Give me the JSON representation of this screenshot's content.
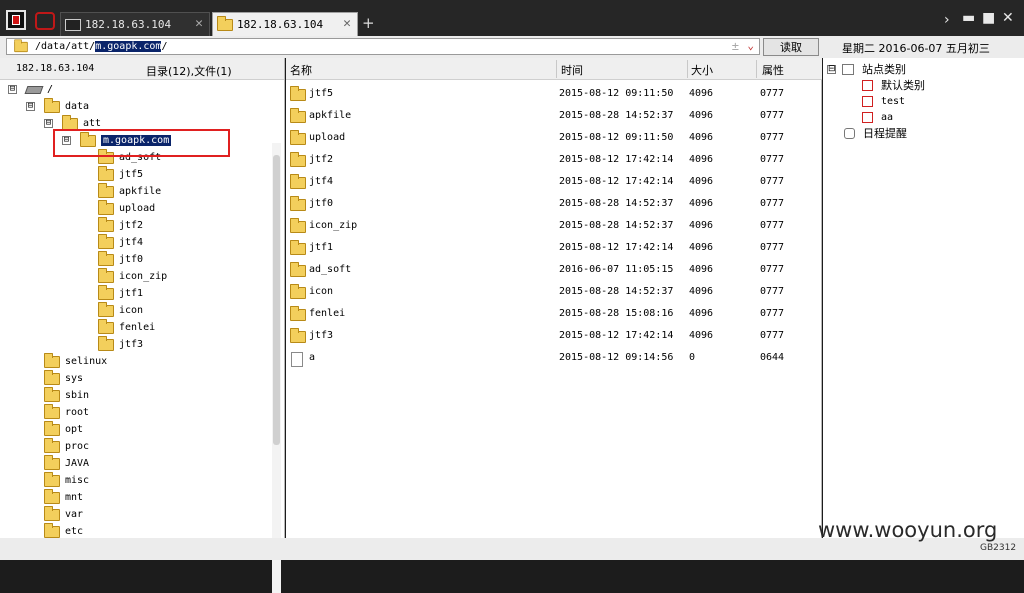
{
  "tabs": [
    {
      "label": "182.18.63.104",
      "active": false
    },
    {
      "label": "182.18.63.104",
      "active": true
    }
  ],
  "window_controls": {
    "more": "›",
    "minimize": "▬",
    "maximize": "■",
    "close": "✕"
  },
  "new_tab": "+",
  "address": {
    "prefix": "/data/att/",
    "selected": "m.goapk.com",
    "suffix": "/",
    "plus": "±",
    "chevron": "⌄"
  },
  "read_button": "读取",
  "date_line": "星期二 2016-06-07 五月初三",
  "left_pane": {
    "host": "182.18.63.104",
    "dir_count": "目录(12),文件(1)",
    "tree": [
      {
        "label": "/",
        "expander": "⊟",
        "icon": "drive-icon"
      },
      {
        "label": "data",
        "expander": "⊟",
        "icon": "folder-icon"
      },
      {
        "label": "att",
        "expander": "⊟",
        "icon": "folder-icon"
      },
      {
        "label": "m.goapk.com",
        "expander": "⊟",
        "icon": "folder-icon",
        "selected": true
      },
      {
        "label": "ad_soft",
        "icon": "folder-icon"
      },
      {
        "label": "jtf5",
        "icon": "folder-icon"
      },
      {
        "label": "apkfile",
        "icon": "folder-icon"
      },
      {
        "label": "upload",
        "icon": "folder-icon"
      },
      {
        "label": "jtf2",
        "icon": "folder-icon"
      },
      {
        "label": "jtf4",
        "icon": "folder-icon"
      },
      {
        "label": "jtf0",
        "icon": "folder-icon"
      },
      {
        "label": "icon_zip",
        "icon": "folder-icon"
      },
      {
        "label": "jtf1",
        "icon": "folder-icon"
      },
      {
        "label": "icon",
        "icon": "folder-icon"
      },
      {
        "label": "fenlei",
        "icon": "folder-icon"
      },
      {
        "label": "jtf3",
        "icon": "folder-icon"
      },
      {
        "label": "selinux",
        "icon": "folder-icon"
      },
      {
        "label": "sys",
        "icon": "folder-icon"
      },
      {
        "label": "sbin",
        "icon": "folder-icon"
      },
      {
        "label": "root",
        "icon": "folder-icon"
      },
      {
        "label": "opt",
        "icon": "folder-icon"
      },
      {
        "label": "proc",
        "icon": "folder-icon"
      },
      {
        "label": "JAVA",
        "icon": "folder-icon"
      },
      {
        "label": "misc",
        "icon": "folder-icon"
      },
      {
        "label": "mnt",
        "icon": "folder-icon"
      },
      {
        "label": "var",
        "icon": "folder-icon"
      },
      {
        "label": "etc",
        "icon": "folder-icon"
      }
    ]
  },
  "file_list": {
    "headers": {
      "name": "名称",
      "time": "时间",
      "size": "大小",
      "attr": "属性"
    },
    "rows": [
      {
        "name": "jtf5",
        "time": "2015-08-12 09:11:50",
        "size": "4096",
        "attr": "0777",
        "icon": "folder-icon"
      },
      {
        "name": "apkfile",
        "time": "2015-08-28 14:52:37",
        "size": "4096",
        "attr": "0777",
        "icon": "folder-icon"
      },
      {
        "name": "upload",
        "time": "2015-08-12 09:11:50",
        "size": "4096",
        "attr": "0777",
        "icon": "folder-icon"
      },
      {
        "name": "jtf2",
        "time": "2015-08-12 17:42:14",
        "size": "4096",
        "attr": "0777",
        "icon": "folder-icon"
      },
      {
        "name": "jtf4",
        "time": "2015-08-12 17:42:14",
        "size": "4096",
        "attr": "0777",
        "icon": "folder-icon"
      },
      {
        "name": "jtf0",
        "time": "2015-08-28 14:52:37",
        "size": "4096",
        "attr": "0777",
        "icon": "folder-icon"
      },
      {
        "name": "icon_zip",
        "time": "2015-08-28 14:52:37",
        "size": "4096",
        "attr": "0777",
        "icon": "folder-icon"
      },
      {
        "name": "jtf1",
        "time": "2015-08-12 17:42:14",
        "size": "4096",
        "attr": "0777",
        "icon": "folder-icon"
      },
      {
        "name": "ad_soft",
        "time": "2016-06-07 11:05:15",
        "size": "4096",
        "attr": "0777",
        "icon": "folder-icon"
      },
      {
        "name": "icon",
        "time": "2015-08-28 14:52:37",
        "size": "4096",
        "attr": "0777",
        "icon": "folder-icon"
      },
      {
        "name": "fenlei",
        "time": "2015-08-28 15:08:16",
        "size": "4096",
        "attr": "0777",
        "icon": "folder-icon"
      },
      {
        "name": "jtf3",
        "time": "2015-08-12 17:42:14",
        "size": "4096",
        "attr": "0777",
        "icon": "folder-icon"
      },
      {
        "name": "a",
        "time": "2015-08-12 09:14:56",
        "size": "0",
        "attr": "0644",
        "icon": "file-icon"
      }
    ]
  },
  "right_pane": {
    "root_label": "站点类别",
    "categories": [
      "默认类别",
      "test",
      "aa"
    ],
    "reminder": "日程提醒",
    "expander": "⊟"
  },
  "watermark": "www.wooyun.org",
  "encoding": "GB2312",
  "colors": {
    "selection": "#0a246a",
    "highlight_box": "#e02020",
    "folder": "#f3cf5c"
  }
}
